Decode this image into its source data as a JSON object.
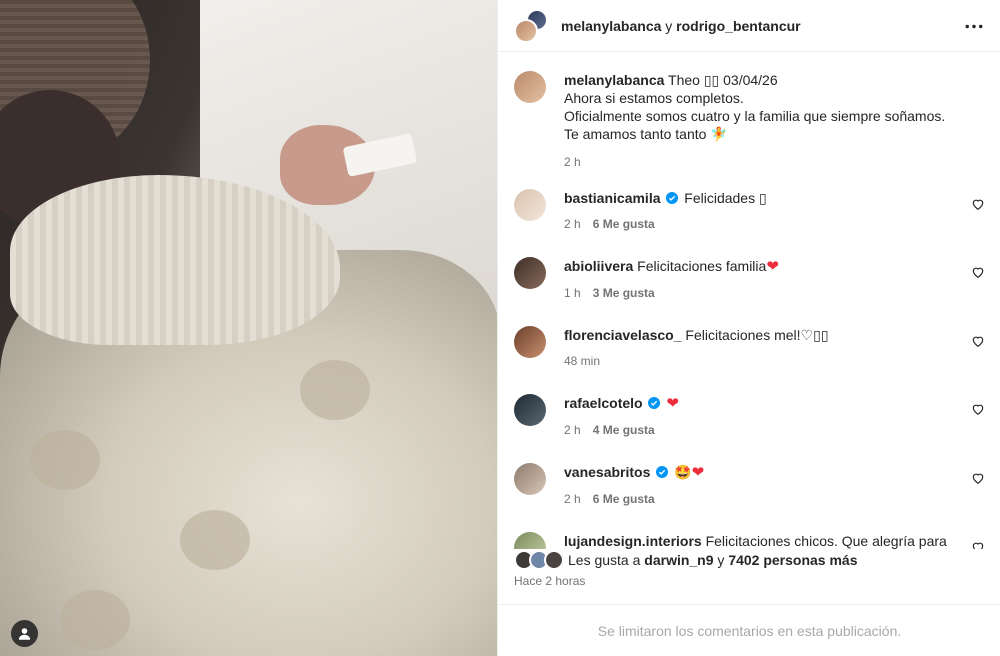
{
  "post_photo": {
    "profile_button_icon": "person-icon"
  },
  "header": {
    "user1": "melanylabanca",
    "separator": "y",
    "user2": "rodrigo_bentancur",
    "more_icon": "more-horizontal-icon"
  },
  "caption": {
    "username": "melanylabanca",
    "line1": "Theo ▯▯ 03/04/26",
    "line2": "Ahora si estamos completos.",
    "line3": "Oficialmente somos cuatro y la familia que siempre soñamos.",
    "line4": "Te amamos tanto tanto 🧚",
    "time": "2 h"
  },
  "comments": [
    {
      "username": "bastianicamila",
      "verified": true,
      "text": "Felicidades ▯",
      "time": "2 h",
      "likes": "6 Me gusta"
    },
    {
      "username": "abioliivera",
      "verified": false,
      "text": "Felicitaciones familia",
      "heart": "❤",
      "time": "1 h",
      "likes": "3 Me gusta"
    },
    {
      "username": "florenciavelasco_",
      "verified": false,
      "text": "Felicitaciones mel!♡▯▯",
      "time": "48 min",
      "likes": ""
    },
    {
      "username": "rafaelcotelo",
      "verified": true,
      "text": "",
      "heart": "❤",
      "time": "2 h",
      "likes": "4 Me gusta"
    },
    {
      "username": "vanesabritos",
      "verified": true,
      "text": "🤩",
      "heart": "❤",
      "time": "2 h",
      "likes": "6 Me gusta"
    },
    {
      "username": "lujandesign.interiors",
      "verified": false,
      "text": "Felicitaciones chicos. Que alegría para",
      "time": "",
      "likes": ""
    }
  ],
  "likes_summary": {
    "prefix": "Les gusta a",
    "user": "darwin_n9",
    "connector": "y",
    "others": "7402 personas más"
  },
  "time_ago": "Hace 2 horas",
  "comments_limited": "Se limitaron los comentarios en esta publicación.",
  "colors": {
    "verified_blue": "#0095f6",
    "heart_red": "#ed2d3c",
    "muted_text": "#737373"
  }
}
